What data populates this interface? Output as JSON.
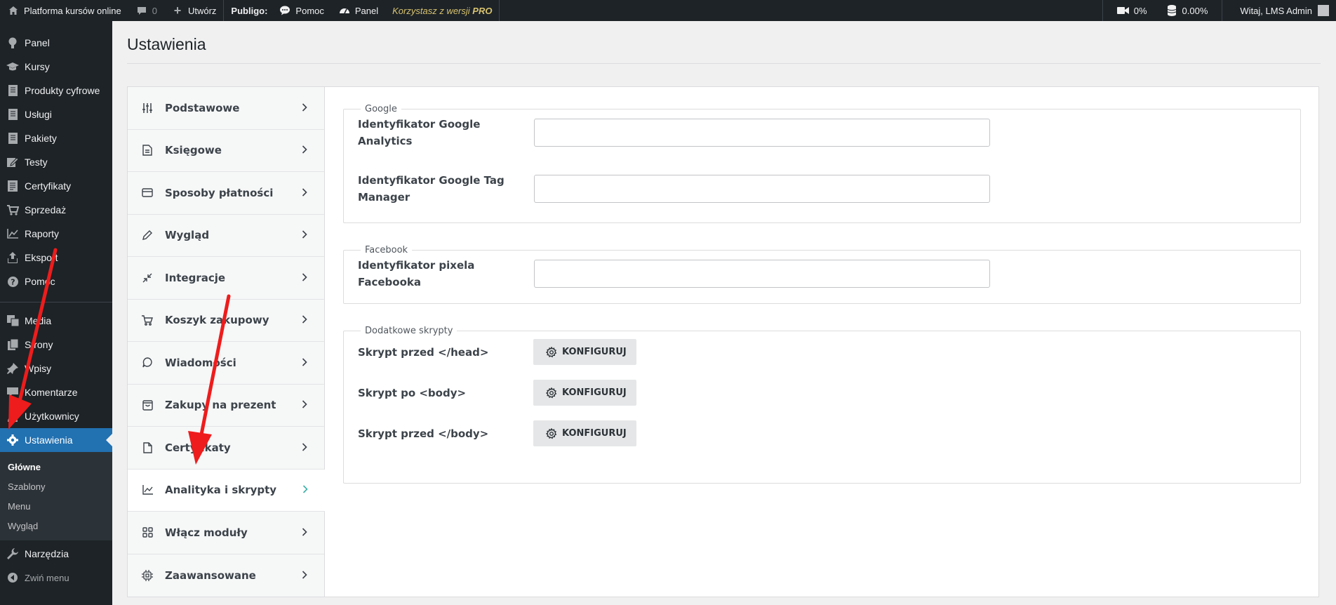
{
  "adminbar": {
    "site_name": "Platforma kursów online",
    "comments_count": "0",
    "new_label": "Utwórz",
    "publigo_label": "Publigo:",
    "help_label": "Pomoc",
    "panel_label": "Panel",
    "pro_text": "Korzystasz z wersji",
    "pro_badge": "PRO",
    "video_stat": "0%",
    "db_stat": "0.00%",
    "greeting": "Witaj, LMS Admin"
  },
  "sidebar": {
    "items": [
      {
        "label": "Panel",
        "icon": "dashboard-icon"
      },
      {
        "label": "Kursy",
        "icon": "graduation-cap-icon"
      },
      {
        "label": "Produkty cyfrowe",
        "icon": "document-icon"
      },
      {
        "label": "Usługi",
        "icon": "document-icon"
      },
      {
        "label": "Pakiety",
        "icon": "document-icon"
      },
      {
        "label": "Testy",
        "icon": "edit-icon"
      },
      {
        "label": "Certyfikaty",
        "icon": "certificate-icon"
      },
      {
        "label": "Sprzedaż",
        "icon": "cart-icon"
      },
      {
        "label": "Raporty",
        "icon": "chart-icon"
      },
      {
        "label": "Eksport",
        "icon": "export-icon"
      },
      {
        "label": "Pomoc",
        "icon": "help-icon"
      }
    ],
    "items2": [
      {
        "label": "Media",
        "icon": "media-icon"
      },
      {
        "label": "Strony",
        "icon": "pages-icon"
      },
      {
        "label": "Wpisy",
        "icon": "pin-icon"
      },
      {
        "label": "Komentarze",
        "icon": "comments-icon"
      },
      {
        "label": "Użytkownicy",
        "icon": "users-icon"
      }
    ],
    "active": {
      "label": "Ustawienia",
      "icon": "settings-icon"
    },
    "submenu": [
      "Główne",
      "Szablony",
      "Menu",
      "Wygląd"
    ],
    "tools_label": "Narzędzia",
    "collapse_label": "Zwiń menu"
  },
  "page": {
    "title": "Ustawienia"
  },
  "tabs": [
    {
      "label": "Podstawowe",
      "icon": "sliders-icon"
    },
    {
      "label": "Księgowe",
      "icon": "invoice-icon"
    },
    {
      "label": "Sposoby płatności",
      "icon": "credit-card-icon"
    },
    {
      "label": "Wygląd",
      "icon": "pencil-icon"
    },
    {
      "label": "Integracje",
      "icon": "integration-icon"
    },
    {
      "label": "Koszyk zakupowy",
      "icon": "cart-icon"
    },
    {
      "label": "Wiadomości",
      "icon": "message-icon"
    },
    {
      "label": "Zakupy na prezent",
      "icon": "gift-bag-icon"
    },
    {
      "label": "Certyfikaty",
      "icon": "file-icon"
    },
    {
      "label": "Analityka i skrypty",
      "icon": "analytics-icon",
      "active": true
    },
    {
      "label": "Włącz moduły",
      "icon": "grid-icon"
    },
    {
      "label": "Zaawansowane",
      "icon": "chip-icon"
    }
  ],
  "google": {
    "legend": "Google",
    "ga_label": "Identyfikator Google Analytics",
    "ga_value": "",
    "gtm_label": "Identyfikator Google Tag Manager",
    "gtm_value": ""
  },
  "facebook": {
    "legend": "Facebook",
    "pixel_label": "Identyfikator pixela Facebooka",
    "pixel_value": ""
  },
  "scripts": {
    "legend": "Dodatkowe skrypty",
    "items": [
      {
        "label": "Skrypt przed </head>",
        "button": "KONFIGURUJ"
      },
      {
        "label": "Skrypt po <body>",
        "button": "KONFIGURUJ"
      },
      {
        "label": "Skrypt przed </body>",
        "button": "KONFIGURUJ"
      }
    ]
  }
}
